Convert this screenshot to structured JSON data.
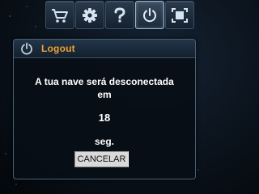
{
  "toolbar": {
    "buttons": [
      {
        "icon": "cart-icon"
      },
      {
        "icon": "gear-icon"
      },
      {
        "icon": "help-icon"
      },
      {
        "icon": "power-icon",
        "active": true
      },
      {
        "icon": "fullscreen-icon"
      }
    ]
  },
  "dialog": {
    "title": "Logout",
    "message_line1": "A tua nave será desconectada",
    "message_line2": "em",
    "countdown": "18",
    "unit": "seg.",
    "cancel_label": "CANCELAR",
    "title_color": "#f0a232"
  }
}
